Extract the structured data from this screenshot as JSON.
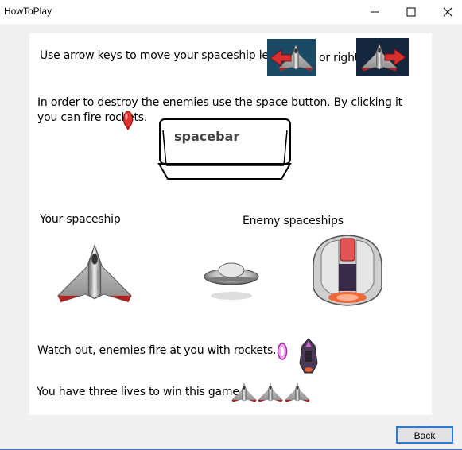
{
  "window": {
    "title": "HowToPlay",
    "controls": [
      "minimize",
      "maximize",
      "close"
    ]
  },
  "instructions": {
    "move_prefix": "Use arrow keys to move your spaceship left",
    "move_mid": "or right",
    "fire_text": "In order to destroy the enemies use the space button. By clicking it you can fire rockets.",
    "spacebar_key": "spacebar",
    "your_ship_label": "Your spaceship",
    "enemy_ships_label": "Enemy spaceships",
    "watch_out": "Watch out, enemies fire at you with rockets.",
    "lives": "You have three lives to win this game."
  },
  "icons": {
    "left_arrow": "ship-left-arrow-icon",
    "right_arrow": "ship-right-arrow-icon",
    "rocket": "rocket-icon",
    "player_ship": "player-spaceship-icon",
    "ufo": "ufo-enemy-icon",
    "mothership": "mothership-enemy-icon",
    "enemy_rocket": "enemy-rocket-icon",
    "enemy_fighter": "enemy-fighter-icon",
    "life": "life-ship-icon"
  },
  "lives_count": 3,
  "footer": {
    "back_label": "Back"
  },
  "colors": {
    "accent": "#2d7bd0",
    "panel": "#ffffff",
    "background": "#f0f0f0"
  }
}
